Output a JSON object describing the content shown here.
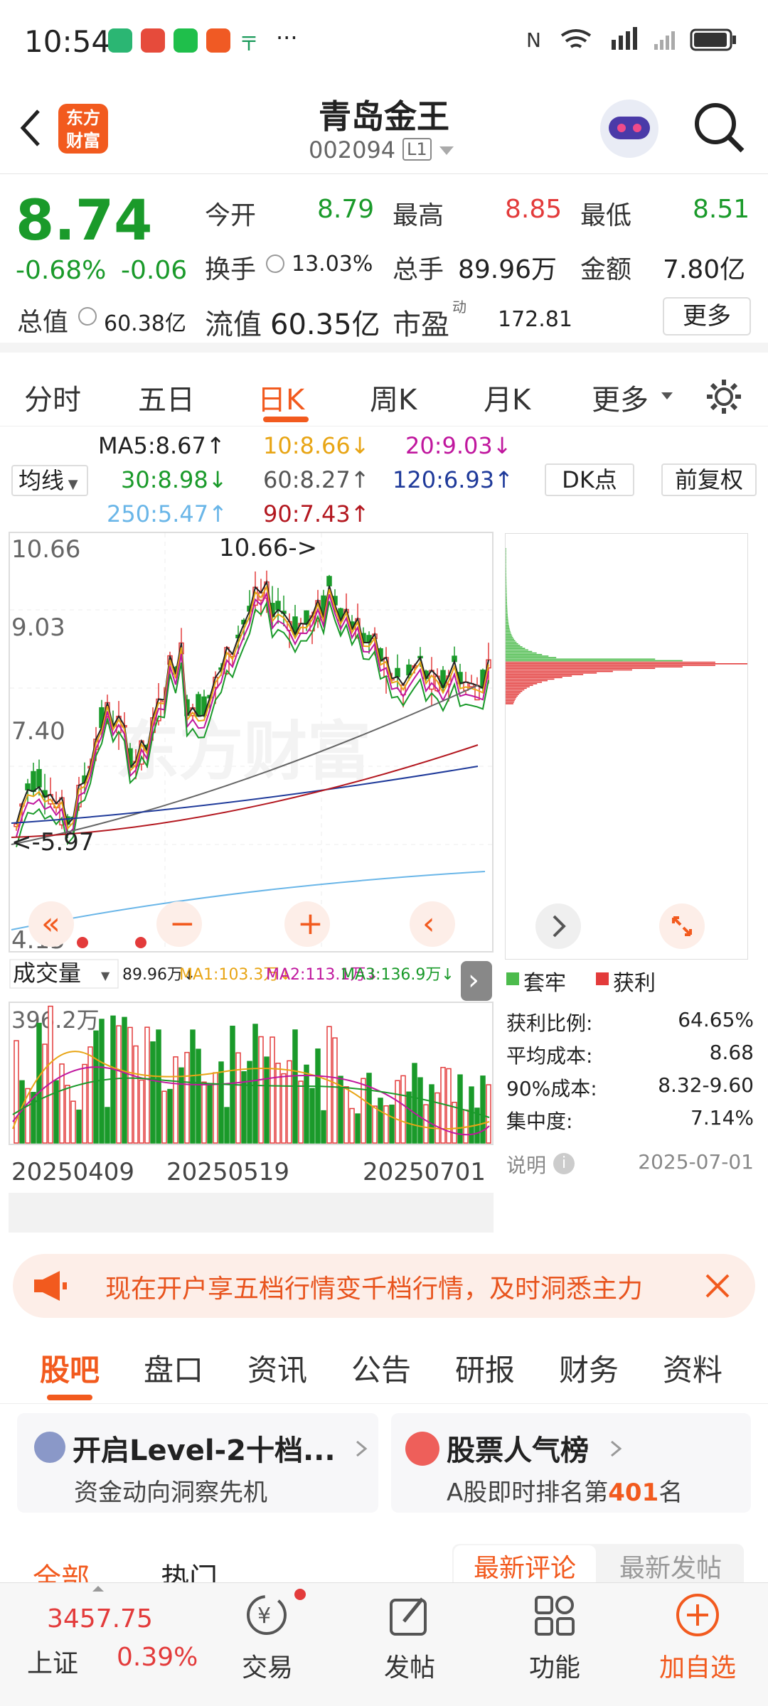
{
  "status": {
    "time": "10:54",
    "dots": "···"
  },
  "header": {
    "logo": "东方\n财富",
    "title": "青岛金王",
    "code": "002094",
    "level": "L1"
  },
  "quote": {
    "price": "8.74",
    "pct": "-0.68%",
    "chg": "-0.06",
    "open_label": "今开",
    "open": "8.79",
    "high_label": "最高",
    "high": "8.85",
    "low_label": "最低",
    "low": "8.51",
    "turn_label": "换手",
    "turn": "13.03%",
    "vol_label": "总手",
    "vol": "89.96万",
    "amt_label": "金额",
    "amt": "7.80亿",
    "mcap_label": "总值",
    "mcap": "60.38亿",
    "fmcap_label": "流值",
    "fmcap": "60.35亿",
    "pe_label": "市盈",
    "pe_sup": "动",
    "pe": "172.81",
    "more": "更多"
  },
  "tabs1": [
    "分时",
    "五日",
    "日K",
    "周K",
    "月K",
    "更多"
  ],
  "ma": {
    "junxian": "均线",
    "ma5": "MA5:8.67↑",
    "ma10": "10:8.66↓",
    "ma20": "20:9.03↓",
    "ma30": "30:8.98↓",
    "ma60": "60:8.27↑",
    "ma120": "120:6.93↑",
    "ma250": "250:5.47↑",
    "ma90": "90:7.43↑",
    "dk": "DK点",
    "fq": "前复权"
  },
  "kline": {
    "y_top": "10.66",
    "y_mid": "9.03",
    "y_low": "7.40",
    "y_bottom": "4.15",
    "max_label": "10.66->",
    "min_label": "<-5.97",
    "watermark": "东方财富"
  },
  "volume": {
    "label": "成交量",
    "v": "89.96万↓",
    "ma1": "MA1:103.3万↓",
    "ma2": "MA2:113.1万↓",
    "ma3": "MA3:136.9万↓",
    "ymax": "396.2万",
    "dates": [
      "20250409",
      "20250519",
      "20250701"
    ]
  },
  "chip": {
    "legend1": "套牢",
    "legend2": "获利",
    "rows": [
      {
        "k": "获利比例:",
        "v": "64.65%"
      },
      {
        "k": "平均成本:",
        "v": "8.68"
      },
      {
        "k": "90%成本:",
        "v": "8.32-9.60"
      },
      {
        "k": "集中度:",
        "v": "7.14%"
      }
    ],
    "note": "说明",
    "date": "2025-07-01"
  },
  "banner": "现在开户享五档行情变千档行情，及时洞悉主力",
  "tabs2": [
    "股吧",
    "盘口",
    "资讯",
    "公告",
    "研报",
    "财务",
    "资料"
  ],
  "card1": {
    "title": "开启Level-2十档...",
    "sub": "资金动向洞察先机"
  },
  "card2": {
    "title": "股票人气榜",
    "sub_a": "A股即时排名第",
    "rank": "401",
    "sub_b": "名"
  },
  "subtabs": {
    "all": "全部",
    "hot": "热门",
    "latest_comment": "最新评论",
    "latest_post": "最新发帖"
  },
  "bottom": {
    "index_val": "3457.75",
    "index_name": "上证",
    "index_pct": "0.39%",
    "trade": "交易",
    "post": "发帖",
    "func": "功能",
    "add": "加自选"
  },
  "colors": {
    "accent": "#f25a1e",
    "up": "#e33b3b",
    "down": "#1a9a2a"
  }
}
